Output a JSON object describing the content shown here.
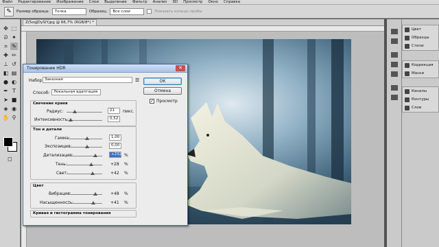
{
  "menu": [
    "Файл",
    "Редактирование",
    "Изображение",
    "Слои",
    "Выделение",
    "Фильтр",
    "Анализ",
    "3D",
    "Просмотр",
    "Окно",
    "Справка"
  ],
  "options": {
    "size_label": "Размер образца:",
    "size_value": "Точка",
    "sample_label": "Образец:",
    "sample_value": "Все слои",
    "ring_label": "Показать кольцо пробы"
  },
  "document": {
    "tab": "Z(5oqJDySiY.jpg @ 66,7% (RGB/8*) *"
  },
  "dock": {
    "groups": [
      [
        "Цвет",
        "Образцы",
        "Стили"
      ],
      [
        "Коррекция",
        "Маски"
      ],
      [
        "Каналы",
        "Контуры",
        "Слои"
      ]
    ]
  },
  "dialog": {
    "title": "Тонирование HDR",
    "preset_label": "Набор:",
    "preset_value": "Заказная",
    "method_label": "Способ:",
    "method_value": "Локальная адаптация",
    "ok": "ОК",
    "cancel": "Отмена",
    "preview_label": "Просмотр",
    "edge_glow": {
      "title": "Свечение краев",
      "radius_label": "Радиус:",
      "radius_value": "21",
      "radius_unit": "пикс.",
      "strength_label": "Интенсивность:",
      "strength_value": "0,52"
    },
    "tone_detail": {
      "title": "Тон и детали",
      "gamma_label": "Гамма:",
      "gamma_value": "1,00",
      "exposure_label": "Экспозиция:",
      "exposure_value": "0,00",
      "detail_label": "Детализация:",
      "detail_value": "+232",
      "shadow_label": "Тень:",
      "shadow_value": "+28",
      "highlight_label": "Свет:",
      "highlight_value": "+42",
      "pct": "%"
    },
    "color": {
      "title": "Цвет",
      "vibrance_label": "Вибрация:",
      "vibrance_value": "+48",
      "saturation_label": "Насыщенность:",
      "saturation_value": "+41",
      "pct": "%"
    },
    "curve_title": "Кривая и гистограмма тонирования"
  }
}
